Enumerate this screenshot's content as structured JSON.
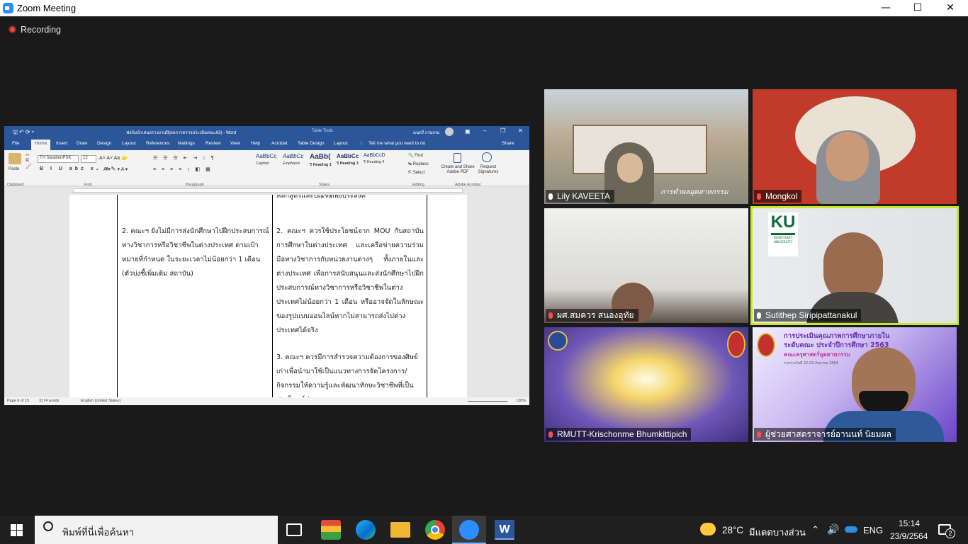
{
  "window": {
    "title": "Zoom Meeting",
    "controls": [
      "—",
      "☐",
      "✕"
    ]
  },
  "recording": {
    "label": "Recording"
  },
  "word": {
    "doc_title": "ฟอร์มนำเสนอรายงานปิ(ผลการตรวจประเมินคณะ63) - Word",
    "table_tools": "Table Tools",
    "user": "มนตรี กรมเกม",
    "tabs": [
      "File",
      "Home",
      "Insert",
      "Draw",
      "Design",
      "Layout",
      "References",
      "Mailings",
      "Review",
      "View",
      "Help",
      "Acrobat",
      "Table Design",
      "Layout"
    ],
    "tell_me": "Tell me what you want to do",
    "share": "Share",
    "font_name": "TH SarabunPSK",
    "font_size": "12",
    "styles": [
      {
        "sample": "AaBbCc",
        "name": "Caption"
      },
      {
        "sample": "AaBbCc",
        "name": "Emphasis"
      },
      {
        "sample": "AaBb(",
        "name": "¶ Heading 1"
      },
      {
        "sample": "AaBbCc",
        "name": "¶ Heading 3"
      },
      {
        "sample": "AaBbCcD",
        "name": "¶ Heading 4"
      }
    ],
    "editing": [
      "Find",
      "Replace",
      "Select"
    ],
    "acrobat": [
      "Create and Share Adobe PDF",
      "Request Signatures"
    ],
    "groups": [
      "Clipboard",
      "Font",
      "Paragraph",
      "Styles",
      "Editing",
      "Adobe Acrobat"
    ],
    "paste": "Paste",
    "cells": {
      "mid1": "2. คณะฯ ยังไม่มีการส่งนักศึกษาไปฝึกประสบการณ์ทางวิชาการหรือวิชาชีพในต่างประเทศ ตามเป้าหมายที่กำหนด ในระยะเวลาไม่น้อยกว่า 1 เดือน (ตัวบ่งชี้เพิ่มเติม สถาบัน)",
      "right0": "หลักสูตรและบัณฑิตพึงประสงค์",
      "right1": "2. คณะฯ ควรใช้ประโยชน์จาก MOU กับสถาบันการศึกษาในต่างประเทศ และเครือข่ายความร่วมมือทางวิชาการกับหน่วยงานต่างๆ ทั้งภายในและต่างประเทศ เพื่อการสนับสนุนและส่งนักศึกษาไปฝึกประสบการณ์ทางวิชาการหรือวิชาชีพในต่างประเทศไม่น้อยกว่า 1 เดือน หรืออาจจัดในลักษณะของรูปแบบออนไลน์หากไม่สามารถส่งไปต่างประเทศได้จริง",
      "right2": "3. คณะฯ ควรมีการสำรวจความต้องการของศิษย์เก่าเพื่อนำมาใช้เป็นแนวทางการจัดโครงการ/กิจกรรมให้ความรู้และพัฒนาทักษะวิชาชีพที่เป็นประโยชน์ต่อ"
    },
    "status": {
      "page": "Page 6 of 15",
      "words": "3174 words",
      "lang": "English (United States)",
      "zoom": "130%"
    }
  },
  "participants": [
    {
      "name": "Lily KAVEETA",
      "muted": false
    },
    {
      "name": "Mongkol",
      "muted": true
    },
    {
      "name": "ผศ.สมควร สนองอุทัย",
      "muted": true
    },
    {
      "name": "Sutithep Siripipattanakul",
      "muted": false,
      "speaking": true
    },
    {
      "name": "RMUTT-Krischonme Bhumkittipich",
      "muted": true
    },
    {
      "name": "ผู้ช่วยศาสตราจารย์อานนท์ นิยมผล",
      "muted": true
    }
  ],
  "tile_text": {
    "lily_caption": "การทำผลอุตสาหกรรม",
    "ku_logo": "KU",
    "ku_sub": "KASETSART UNIVERSITY",
    "banner_line1": "การประเมินคุณภาพการศึกษาภายใน",
    "banner_line2": "ระดับคณะ ประจำปีการศึกษา 2563",
    "banner_line3": "คณะครุศาสตร์อุตสาหกรรม",
    "banner_line4": "ระหว่างวันที่ 22-23 กันยายน 2564"
  },
  "taskbar": {
    "search_placeholder": "พิมพ์ที่นี่เพื่อค้นหา",
    "weather": "28°C",
    "weather_text": "มีแดดบางส่วน",
    "lang": "ENG",
    "time": "15:14",
    "date": "23/9/2564",
    "notif_count": "2"
  }
}
